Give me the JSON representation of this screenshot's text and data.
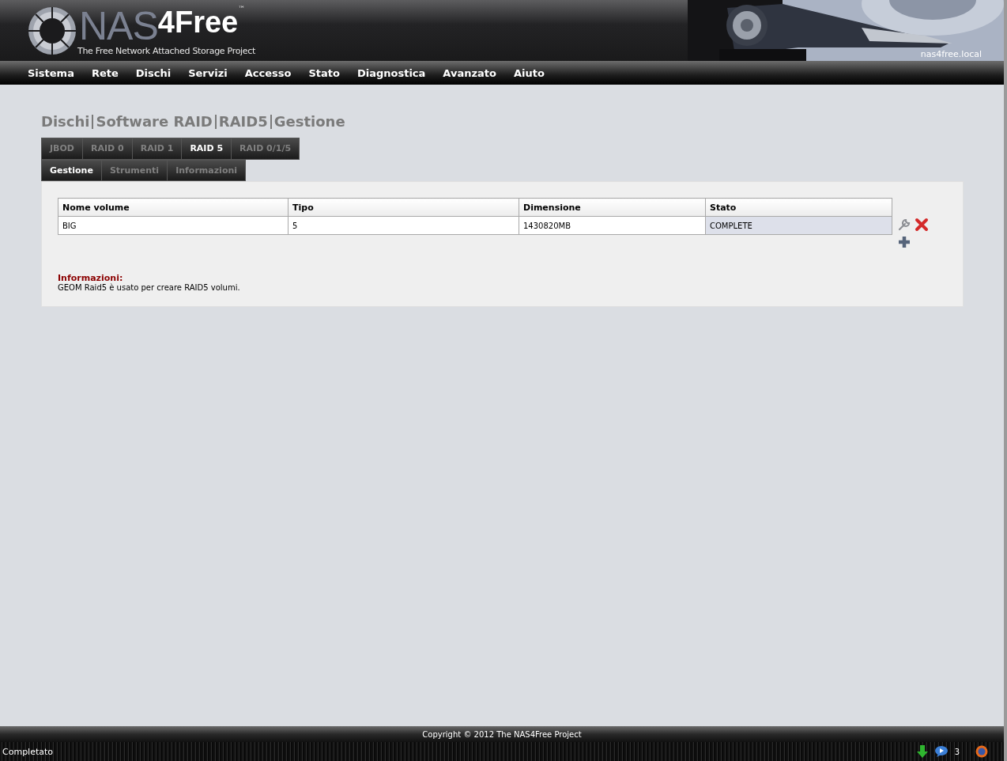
{
  "header": {
    "logo_main": "NAS",
    "logo_accent": "4Free",
    "logo_mark": "™",
    "tagline": "The Free Network Attached Storage Project",
    "hostname": "nas4free.local"
  },
  "nav": [
    "Sistema",
    "Rete",
    "Dischi",
    "Servizi",
    "Accesso",
    "Stato",
    "Diagnostica",
    "Avanzato",
    "Aiuto"
  ],
  "breadcrumb": [
    "Dischi",
    "Software RAID",
    "RAID5",
    "Gestione"
  ],
  "tabs": [
    {
      "label": "JBOD",
      "selected": false
    },
    {
      "label": "RAID 0",
      "selected": false
    },
    {
      "label": "RAID 1",
      "selected": false
    },
    {
      "label": "RAID 5",
      "selected": true
    },
    {
      "label": "RAID 0/1/5",
      "selected": false
    }
  ],
  "subtabs": [
    {
      "label": "Gestione",
      "selected": true
    },
    {
      "label": "Strumenti",
      "selected": false
    },
    {
      "label": "Informazioni",
      "selected": false
    }
  ],
  "table": {
    "columns": [
      "Nome volume",
      "Tipo",
      "Dimensione",
      "Stato"
    ],
    "rows": [
      {
        "cells": [
          {
            "text": "BIG",
            "highlighted": false
          },
          {
            "text": "5",
            "highlighted": false
          },
          {
            "text": "1430820MB",
            "highlighted": false
          },
          {
            "text": "COMPLETE",
            "highlighted": true
          }
        ]
      }
    ]
  },
  "info": {
    "title": "Informazioni:",
    "text": "GEOM Raid5 è usato per creare RAID5 volumi."
  },
  "footer": "Copyright © 2012 The NAS4Free Project",
  "status_bar": {
    "text": "Completato",
    "count": "3"
  }
}
